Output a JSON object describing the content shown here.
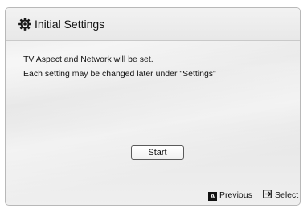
{
  "dialog": {
    "title": "Initial Settings",
    "title_icon": "gear-icon",
    "message_line1": "TV Aspect and Network will be set.",
    "message_line2": "Each setting may be changed later under \"Settings\"",
    "start_label": "Start"
  },
  "footer": {
    "previous_key": "A",
    "previous_label": "Previous",
    "select_icon": "enter-icon",
    "select_label": "Select"
  }
}
